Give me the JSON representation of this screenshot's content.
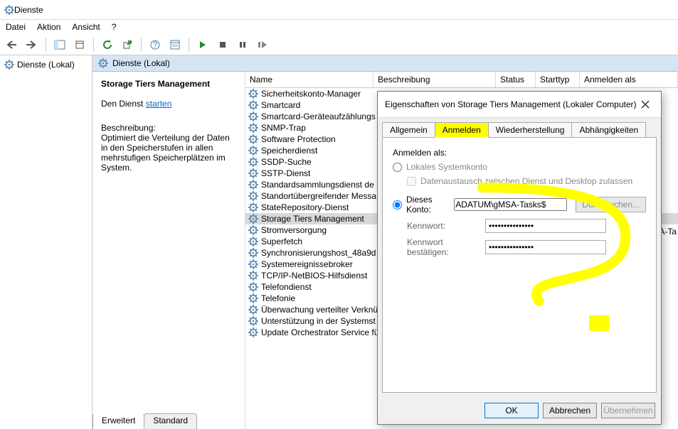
{
  "window": {
    "title": "Dienste"
  },
  "menu": {
    "file": "Datei",
    "action": "Aktion",
    "view": "Ansicht",
    "help": "?"
  },
  "tree": {
    "root": "Dienste (Lokal)"
  },
  "content": {
    "header": "Dienste (Lokal)"
  },
  "detail": {
    "name": "Storage Tiers Management",
    "start_prefix": "Den Dienst ",
    "start_link": "starten",
    "desc_label": "Beschreibung:",
    "desc_text": "Optimiert die Verteilung der Daten in den Speicherstufen in allen mehrstufigen Speicherplätzen im System."
  },
  "columns": {
    "name": "Name",
    "desc": "Beschreibung",
    "status": "Status",
    "startup": "Starttyp",
    "logon": "Anmelden als"
  },
  "services": [
    {
      "name": "Sicherheitskonto-Manager"
    },
    {
      "name": "Smartcard"
    },
    {
      "name": "Smartcard-Geräteaufzählungs"
    },
    {
      "name": "SNMP-Trap"
    },
    {
      "name": "Software Protection"
    },
    {
      "name": "Speicherdienst"
    },
    {
      "name": "SSDP-Suche"
    },
    {
      "name": "SSTP-Dienst"
    },
    {
      "name": "Standardsammlungsdienst de"
    },
    {
      "name": "Standortübergreifender Messa"
    },
    {
      "name": "StateRepository-Dienst"
    },
    {
      "name": "Storage Tiers Management",
      "selected": true
    },
    {
      "name": "Stromversorgung"
    },
    {
      "name": "Superfetch"
    },
    {
      "name": "Synchronisierungshost_48a9d"
    },
    {
      "name": "Systemereignissebroker"
    },
    {
      "name": "TCP/IP-NetBIOS-Hilfsdienst"
    },
    {
      "name": "Telefondienst"
    },
    {
      "name": "Telefonie"
    },
    {
      "name": "Überwachung verteilter Verknü"
    },
    {
      "name": "Unterstützung in der Systemst"
    },
    {
      "name": "Update Orchestrator Service fü"
    }
  ],
  "right_trunc": "A-Ta",
  "bottom_tabs": {
    "extended": "Erweitert",
    "standard": "Standard"
  },
  "dialog": {
    "title": "Eigenschaften von Storage Tiers Management (Lokaler Computer)",
    "tabs": {
      "general": "Allgemein",
      "logon": "Anmelden",
      "recovery": "Wiederherstellung",
      "deps": "Abhängigkeiten"
    },
    "body": {
      "logon_as": "Anmelden als:",
      "local_system": "Lokales Systemkonto",
      "allow_desktop": "Datenaustausch zwischen Dienst und Desktop zulassen",
      "this_account": "Dieses Konto:",
      "account_value": "ADATUM\\gMSA-Tasks$",
      "browse": "Durchsuchen...",
      "password": "Kennwort:",
      "password_confirm": "Kennwort bestätigen:",
      "pw_value": "•••••••••••••••"
    },
    "buttons": {
      "ok": "OK",
      "cancel": "Abbrechen",
      "apply": "Übernehmen"
    }
  }
}
